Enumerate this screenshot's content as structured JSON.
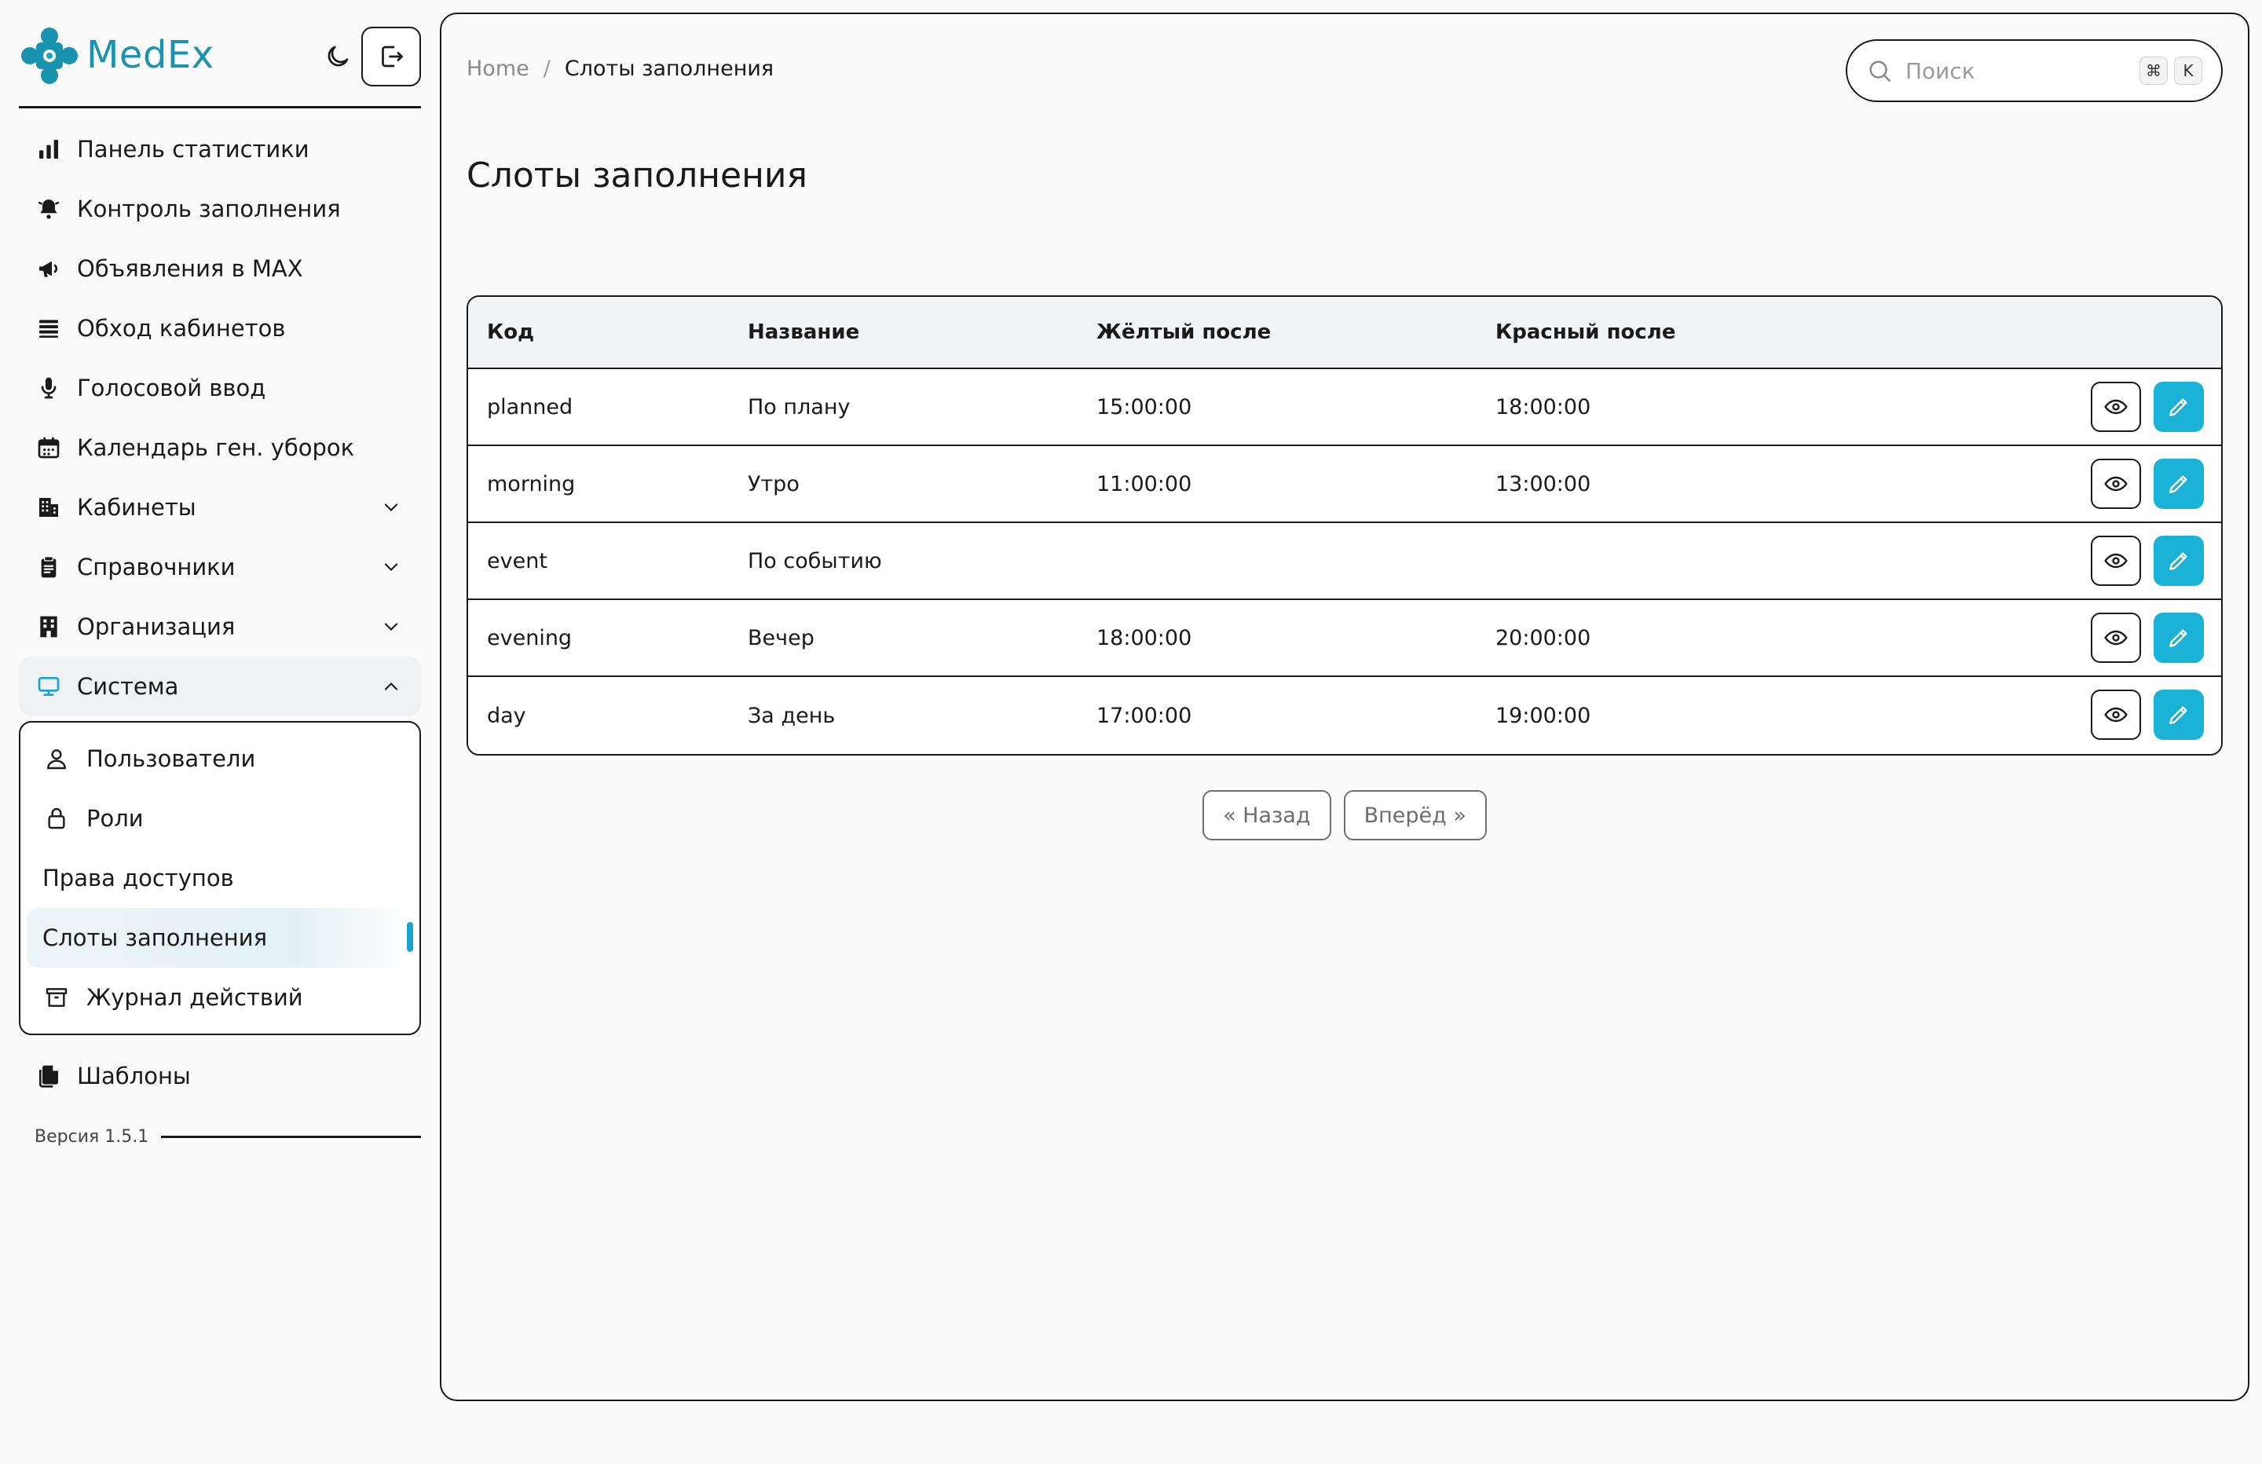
{
  "brand": {
    "name": "MedEx"
  },
  "sidebar": {
    "items": [
      {
        "label": "Панель статистики",
        "icon": "bar-chart-icon"
      },
      {
        "label": "Контроль заполнения",
        "icon": "bell-icon"
      },
      {
        "label": "Объявления в MAX",
        "icon": "megaphone-icon"
      },
      {
        "label": "Обход кабинетов",
        "icon": "list-icon"
      },
      {
        "label": "Голосовой ввод",
        "icon": "microphone-icon"
      },
      {
        "label": "Календарь ген. уборок",
        "icon": "calendar-icon"
      },
      {
        "label": "Кабинеты",
        "icon": "building-icon",
        "expandable": true
      },
      {
        "label": "Справочники",
        "icon": "clipboard-icon",
        "expandable": true
      },
      {
        "label": "Организация",
        "icon": "office-icon",
        "expandable": true
      },
      {
        "label": "Система",
        "icon": "monitor-icon",
        "expandable": true,
        "open": true
      }
    ],
    "system_submenu": [
      {
        "label": "Пользователи",
        "icon": "user-icon"
      },
      {
        "label": "Роли",
        "icon": "lock-icon"
      },
      {
        "label": "Права доступов",
        "icon": ""
      },
      {
        "label": "Слоты заполнения",
        "icon": "",
        "active": true
      },
      {
        "label": "Журнал действий",
        "icon": "archive-icon"
      }
    ],
    "templates": {
      "label": "Шаблоны",
      "icon": "documents-icon"
    },
    "version": "Версия 1.5.1"
  },
  "breadcrumb": {
    "home": "Home",
    "separator": "/",
    "current": "Слоты заполнения"
  },
  "search": {
    "placeholder": "Поиск",
    "value": "",
    "shortcut_mod": "⌘",
    "shortcut_key": "K"
  },
  "page_title": "Слоты заполнения",
  "table": {
    "headers": [
      "Код",
      "Название",
      "Жёлтый после",
      "Красный после"
    ],
    "rows": [
      {
        "code": "planned",
        "name": "По плану",
        "yellow": "15:00:00",
        "red": "18:00:00"
      },
      {
        "code": "morning",
        "name": "Утро",
        "yellow": "11:00:00",
        "red": "13:00:00"
      },
      {
        "code": "event",
        "name": "По событию",
        "yellow": "",
        "red": ""
      },
      {
        "code": "evening",
        "name": "Вечер",
        "yellow": "18:00:00",
        "red": "20:00:00"
      },
      {
        "code": "day",
        "name": "За день",
        "yellow": "17:00:00",
        "red": "19:00:00"
      }
    ]
  },
  "pagination": {
    "prev": "« Назад",
    "next": "Вперёд »"
  },
  "colors": {
    "brand": "#1a93b0",
    "accent": "#1ab2d6",
    "border": "#1a1a1a"
  }
}
